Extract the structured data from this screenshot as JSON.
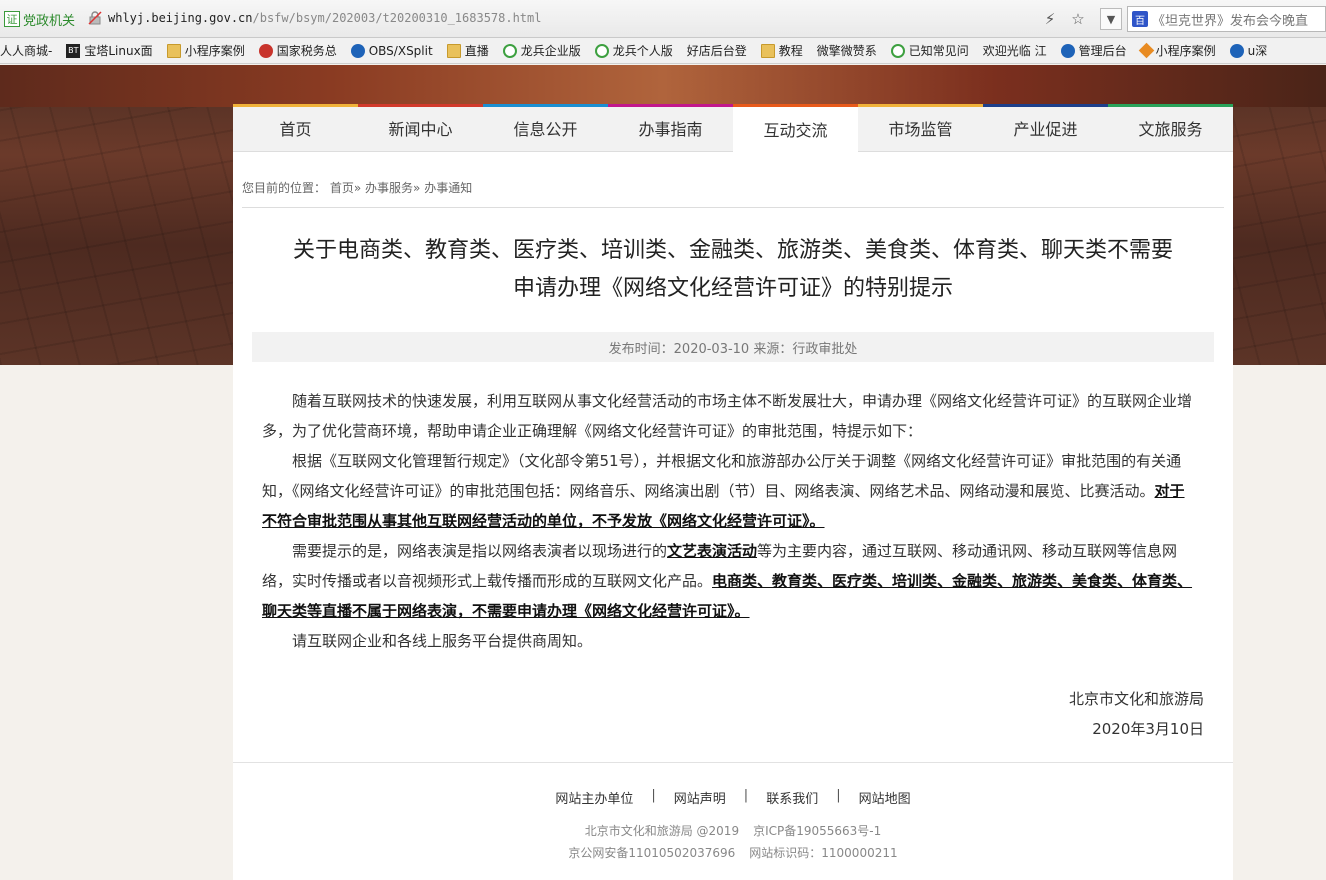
{
  "browser": {
    "cert_label": "党政机关",
    "cert_icon_char": "证",
    "url_host": "whlyj.beijing.gov.cn",
    "url_path": "/bsfw/bsym/202003/t20200310_1683578.html",
    "search_text": "《坦克世界》发布会今晚直",
    "bookmarks": [
      {
        "label": "人人商城-",
        "icon": "page"
      },
      {
        "label": "宝塔Linux面",
        "icon": "dark",
        "glyph": "BT"
      },
      {
        "label": "小程序案例",
        "icon": "folder"
      },
      {
        "label": "国家税务总",
        "icon": "red"
      },
      {
        "label": "OBS/XSplit",
        "icon": "blue"
      },
      {
        "label": "直播",
        "icon": "folder"
      },
      {
        "label": "龙兵企业版",
        "icon": "green"
      },
      {
        "label": "龙兵个人版",
        "icon": "green"
      },
      {
        "label": "好店后台登",
        "icon": "page"
      },
      {
        "label": "教程",
        "icon": "folder"
      },
      {
        "label": "微擎微赞系",
        "icon": "page"
      },
      {
        "label": "已知常见问",
        "icon": "green"
      },
      {
        "label": "欢迎光临 江",
        "icon": "page"
      },
      {
        "label": "管理后台",
        "icon": "blue"
      },
      {
        "label": "小程序案例",
        "icon": "orange"
      },
      {
        "label": "u深",
        "icon": "blue"
      }
    ]
  },
  "nav": {
    "items": [
      {
        "label": "首页",
        "color": "#f0b23a"
      },
      {
        "label": "新闻中心",
        "color": "#d23a2c"
      },
      {
        "label": "信息公开",
        "color": "#1b8fd1"
      },
      {
        "label": "办事指南",
        "color": "#c2188c"
      },
      {
        "label": "互动交流",
        "color": "#e85a1b"
      },
      {
        "label": "市场监管",
        "color": "#f0b23a"
      },
      {
        "label": "产业促进",
        "color": "#1d3f8a"
      },
      {
        "label": "文旅服务",
        "color": "#29a35a"
      }
    ],
    "active_index": 4
  },
  "breadcrumb": {
    "prefix": "您目前的位置：",
    "items": [
      "首页",
      "办事服务",
      "办事通知"
    ],
    "sep": "»"
  },
  "article": {
    "title_line1": "关于电商类、教育类、医疗类、培训类、金融类、旅游类、美食类、体育类、聊天类不需要",
    "title_line2": "申请办理《网络文化经营许可证》的特别提示",
    "publish_label": "发布时间：2020-03-10 来源：行政审批处",
    "p1": "随着互联网技术的快速发展，利用互联网从事文化经营活动的市场主体不断发展壮大，申请办理《网络文化经营许可证》的互联网企业增多，为了优化营商环境，帮助申请企业正确理解《网络文化经营许可证》的审批范围，特提示如下：",
    "p2_plain": "根据《互联网文化管理暂行规定》（文化部令第51号），并根据文化和旅游部办公厅关于调整《网络文化经营许可证》审批范围的有关通知，《网络文化经营许可证》的审批范围包括：网络音乐、网络演出剧（节）目、网络表演、网络艺术品、网络动漫和展览、比赛活动。",
    "p2_bold": "对于不符合审批范围从事其他互联网经营活动的单位，不予发放《网络文化经营许可证》。",
    "p3_a": "需要提示的是，网络表演是指以网络表演者以现场进行的",
    "p3_b": "文艺表演活动",
    "p3_c": "等为主要内容，通过互联网、移动通讯网、移动互联网等信息网络，实时传播或者以音视频形式上载传播而形成的互联网文化产品。",
    "p3_bold": "电商类、教育类、医疗类、培训类、金融类、旅游类、美食类、体育类、聊天类等直播不属于网络表演，不需要申请办理《网络文化经营许可证》。",
    "p4": "请互联网企业和各线上服务平台提供商周知。",
    "sign_org": "北京市文化和旅游局",
    "sign_date": "2020年3月10日"
  },
  "footer": {
    "links": [
      "网站主办单位",
      "网站声明",
      "联系我们",
      "网站地图"
    ],
    "sep": "|",
    "info1a": "北京市文化和旅游局 @2019",
    "info1b": "京ICP备19055663号-1",
    "info2a": "京公网安备11010502037696",
    "info2b": "网站标识码：1100000211"
  }
}
